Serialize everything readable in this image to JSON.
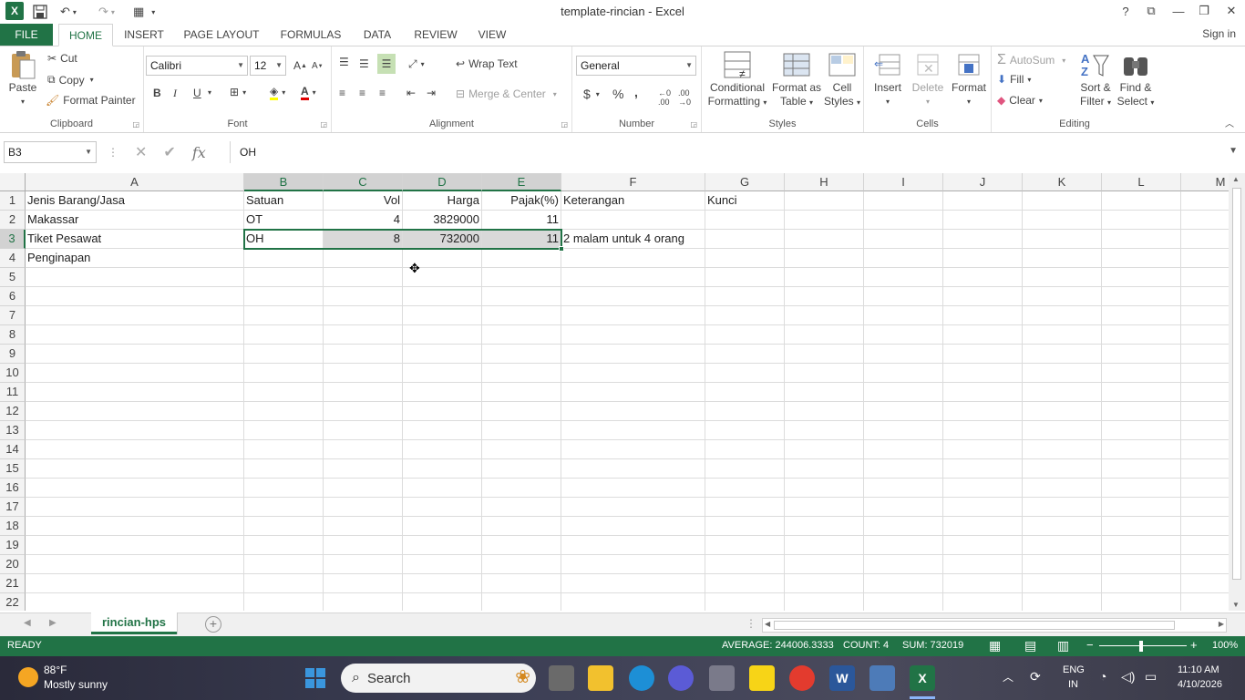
{
  "window": {
    "title": "template-rincian - Excel"
  },
  "tabs": [
    "FILE",
    "HOME",
    "INSERT",
    "PAGE LAYOUT",
    "FORMULAS",
    "DATA",
    "REVIEW",
    "VIEW"
  ],
  "signin": "Sign in",
  "ribbon": {
    "clipboard": {
      "paste": "Paste",
      "cut": "Cut",
      "copy": "Copy",
      "format_painter": "Format Painter",
      "label": "Clipboard"
    },
    "font": {
      "name": "Calibri",
      "size": "12",
      "bold": "B",
      "italic": "I",
      "underline": "U",
      "label": "Font"
    },
    "alignment": {
      "wrap": "Wrap Text",
      "merge": "Merge & Center",
      "label": "Alignment"
    },
    "number": {
      "format": "General",
      "currency": "$",
      "percent": "%",
      "comma": ",",
      "label": "Number"
    },
    "styles": {
      "conditional": "Conditional",
      "conditional2": "Formatting",
      "format_table": "Format as",
      "format_table2": "Table",
      "cell_styles": "Cell",
      "cell_styles2": "Styles",
      "label": "Styles"
    },
    "cells": {
      "insert": "Insert",
      "delete": "Delete",
      "format": "Format",
      "label": "Cells"
    },
    "editing": {
      "autosum": "AutoSum",
      "fill": "Fill",
      "clear": "Clear",
      "sort": "Sort &",
      "sort2": "Filter",
      "find": "Find &",
      "find2": "Select",
      "label": "Editing"
    }
  },
  "formula_bar": {
    "name_box": "B3",
    "fx": "fx",
    "content": "OH"
  },
  "columns": [
    "A",
    "B",
    "C",
    "D",
    "E",
    "F",
    "G",
    "H",
    "I",
    "J",
    "K",
    "L",
    "M"
  ],
  "rows": [
    "1",
    "2",
    "3",
    "4",
    "5",
    "6",
    "7",
    "8",
    "9",
    "10",
    "11",
    "12",
    "13",
    "14",
    "15",
    "16",
    "17",
    "18",
    "19",
    "20",
    "21",
    "22"
  ],
  "cells": {
    "A1": "Jenis Barang/Jasa",
    "B1": "Satuan",
    "C1": "Vol",
    "D1": "Harga",
    "E1": "Pajak(%)",
    "F1": "Keterangan",
    "G1": "Kunci",
    "A2": "Makassar",
    "B2": "OT",
    "C2": "4",
    "D2": "3829000",
    "E2": "11",
    "A3": "Tiket Pesawat",
    "B3": "OH",
    "C3": "8",
    "D3": "732000",
    "E3": "11",
    "F3": "2 malam untuk 4 orang",
    "A4": "Penginapan"
  },
  "sheet": {
    "name": "rincian-hps"
  },
  "status": {
    "mode": "READY",
    "average": "AVERAGE: 244006.3333",
    "count": "COUNT: 4",
    "sum": "SUM: 732019",
    "zoom": "100%"
  },
  "taskbar": {
    "weather_temp": "88°F",
    "weather_desc": "Mostly sunny",
    "search": "Search",
    "lang": "ENG",
    "region": "IN",
    "time": "11:10 AM",
    "date": "4/10/2026"
  },
  "colors": {
    "accent": "#217346",
    "selection": "#d9d9d9"
  }
}
